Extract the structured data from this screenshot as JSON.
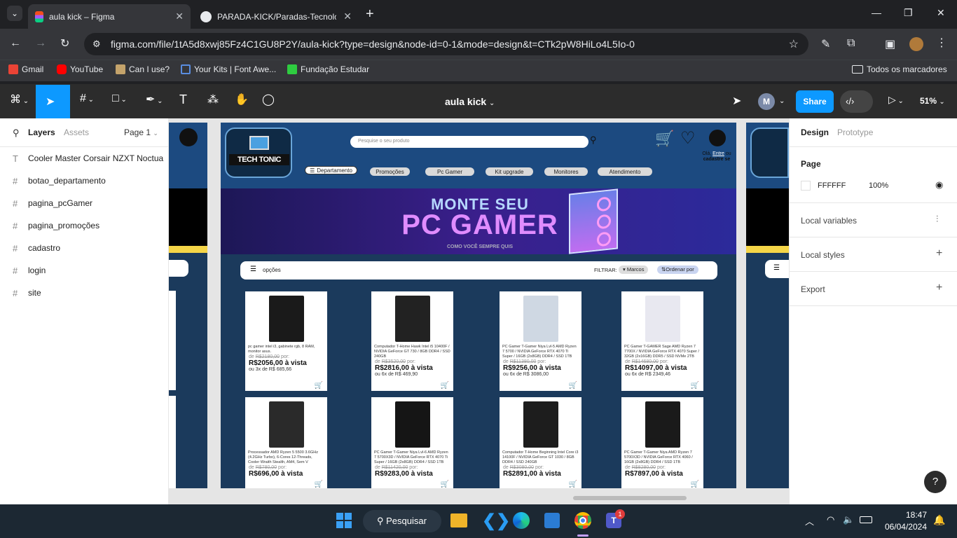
{
  "browser": {
    "tabs": [
      {
        "title": "aula kick – Figma",
        "active": true
      },
      {
        "title": "PARADA-KICK/Paradas-Tecnolog",
        "active": false
      }
    ],
    "url": "figma.com/file/1tA5d8xwj85Fz4C1GU8P2Y/aula-kick?type=design&node-id=0-1&mode=design&t=CTk2pW8HiLo4L5Io-0",
    "bookmarks": [
      "Gmail",
      "YouTube",
      "Can I use?",
      "Your Kits | Font Awe...",
      "Fundação Estudar"
    ],
    "all_bookmarks": "Todos os marcadores"
  },
  "figma": {
    "file_name": "aula kick",
    "avatar_letter": "M",
    "share_label": "Share",
    "zoom": "51%",
    "left_tabs": {
      "layers": "Layers",
      "assets": "Assets",
      "page": "Page 1"
    },
    "layers": [
      {
        "name": "Cooler Master Corsair NZXT Noctua",
        "type": "text"
      },
      {
        "name": "botao_departamento",
        "type": "frame"
      },
      {
        "name": "pagina_pcGamer",
        "type": "frame"
      },
      {
        "name": "pagina_promoções",
        "type": "frame"
      },
      {
        "name": "cadastro",
        "type": "frame"
      },
      {
        "name": "login",
        "type": "frame"
      },
      {
        "name": "site",
        "type": "frame"
      }
    ],
    "right_tabs": {
      "design": "Design",
      "prototype": "Prototype"
    },
    "page_section": {
      "title": "Page",
      "color": "FFFFFF",
      "opacity": "100%"
    },
    "sections": [
      "Local variables",
      "Local styles",
      "Export"
    ],
    "help": "?"
  },
  "site": {
    "logo": "TECH TONIC",
    "search_placeholder": "Pesquise o seu produto",
    "account_text_1": "Olá, ",
    "account_link": "Entre",
    "account_text_2": " ou",
    "account_text_3": "cadastre se",
    "nav": [
      "Departamento",
      "Promoções",
      "Pc Gamer",
      "Kit upgrade",
      "Monitores",
      "Atendimento"
    ],
    "banner_line1": "MONTE SEU",
    "banner_line2": "PC GAMER",
    "banner_line3": "COMO VOCÊ SEMPRE QUIS",
    "filter_bar": {
      "options": "opções",
      "filter": "FILTRAR:",
      "brands": "Marcos",
      "order": "Ordenar por"
    },
    "products": [
      {
        "desc": "pc gamer intel i3, gabinete rgb, 8 RAM, monitor asus.",
        "old": "R$2180,00",
        "price": "R$2056,00 à vista",
        "inst": "ou 3x de R$ 685,66"
      },
      {
        "desc": "Computador T-Home Hawk Intel i5 10400F / NVIDIA GeForce GT 730 / 8GB DDR4 / SSD 240GB",
        "old": "R$3520,00",
        "price": "R$2816,00 à vista",
        "inst": "ou 6x de R$ 469,90"
      },
      {
        "desc": "PC Gamer T-Gamer Niya Lvl-5 AMD Ryzen 7 5700 / NVIDIA GeForce RTX 4070 Ti Super / 16GB (2x8GB) DDR4 / SSD 1TB",
        "old": "R$11380,00",
        "price": "R$9256,00 à vista",
        "inst": "ou 6x de R$ 3086,00"
      },
      {
        "desc": "PC Gamer T-GAMER Sage AMD Ryzen 7 7700X / NVIDIA GeForce RTX 4070 Super / 32GB (2x16GB) DDR5 / SSD NVMe 2TB",
        "old": "R$14680,00",
        "price": "R$14097,00 à vista",
        "inst": "ou 6x de R$ 2349,46"
      },
      {
        "desc": "Processador AMD Ryzen 5 5500 3.6GHz (4.2GHz Turbo), 6-Cores 12-Threads, Cooler Wraith Stealth, AM4, Sem V",
        "old": "R$780,00",
        "price": "R$696,00 à vista",
        "inst": ""
      },
      {
        "desc": "PC Gamer T-Gamer Niya Lvl-6 AMD Ryzen 7 5700X3D / NVIDIA GeForce RTX 4070 Ti Super / 16GB (2x8GB) DDR4 / SSD 1TB",
        "old": "R$11420,00",
        "price": "R$9283,00 à vista",
        "inst": ""
      },
      {
        "desc": "Computador T-Home Beginning Intel Core i3 14100F / NVIDIA GeForce GT 1030 / 8GB DDR4 / SSD 240GB",
        "old": "R$3080,00",
        "price": "R$2891,00 à vista",
        "inst": ""
      },
      {
        "desc": "PC Gamer T-Gamer Niya AMD Ryzen 7 5700X3D / NVIDIA GeForce RTX 4060 / 16GB (2x8GB) DDR4 / SSD 1TB",
        "old": "R$8280,00",
        "price": "R$7897,00 à vista",
        "inst": ""
      }
    ],
    "de_label": "de ",
    "por_label": " por:"
  },
  "taskbar": {
    "search": "Pesquisar",
    "time": "18:47",
    "date": "06/04/2024",
    "teams_badge": "1"
  }
}
